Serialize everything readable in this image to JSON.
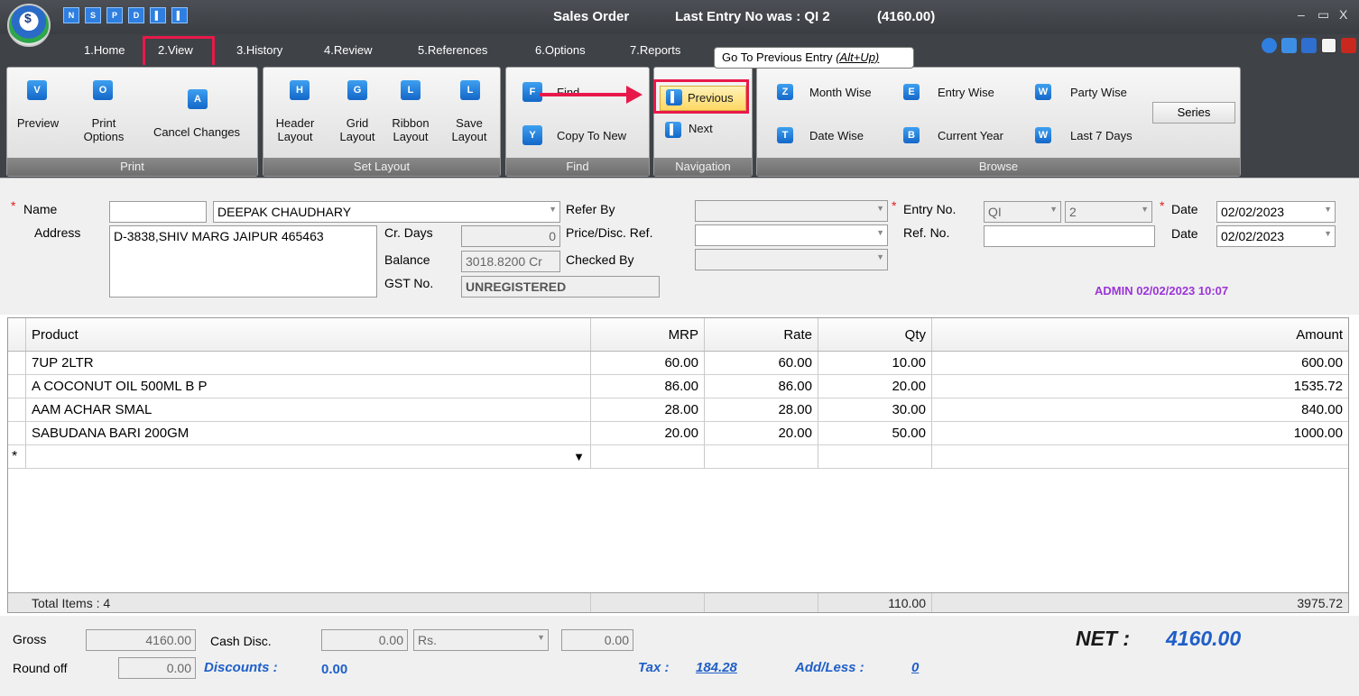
{
  "window": {
    "title": "Sales Order",
    "last_entry": "Last Entry No was : QI 2",
    "last_amount": "(4160.00)",
    "minimize": "–",
    "maximize": "▭",
    "close": "X"
  },
  "quick_access": [
    "N",
    "S",
    "P",
    "D",
    "▌",
    "▌"
  ],
  "menu": [
    "1.Home",
    "2.View",
    "3.History",
    "4.Review",
    "5.References",
    "6.Options",
    "7.Reports"
  ],
  "tooltip": {
    "text": "Go To Previous Entry ",
    "shortcut": "(Alt+Up)"
  },
  "ribbon": {
    "print": {
      "footer": "Print",
      "preview": "Preview",
      "print_options_1": "Print",
      "print_options_2": "Options",
      "cancel": "Cancel Changes",
      "icons": [
        "V",
        "O",
        "A"
      ]
    },
    "layout": {
      "footer": "Set Layout",
      "header": [
        "Header",
        "Layout"
      ],
      "grid": [
        "Grid",
        "Layout"
      ],
      "ribbon": [
        "Ribbon",
        "Layout"
      ],
      "save": [
        "Save",
        "Layout"
      ],
      "icons": [
        "H",
        "G",
        "L",
        "L"
      ]
    },
    "find": {
      "footer": "Find",
      "find": "Find",
      "copy": "Copy To New",
      "icons": [
        "F",
        "Y"
      ]
    },
    "navigation": {
      "footer": "Navigation",
      "previous": "Previous",
      "next": "Next"
    },
    "browse": {
      "footer": "Browse",
      "month": "Month Wise",
      "entry": "Entry Wise",
      "party": "Party Wise",
      "series": "Series",
      "date": "Date Wise",
      "current_year": "Current Year",
      "last7": "Last 7 Days",
      "icons": [
        "Z",
        "E",
        "W",
        "T",
        "B",
        "W"
      ]
    }
  },
  "form": {
    "name_label": "Name",
    "name_value": "DEEPAK CHAUDHARY",
    "address_label": "Address",
    "address_value": "D-3838,SHIV MARG JAIPUR 465463",
    "crdays_label": "Cr. Days",
    "crdays_value": "0",
    "balance_label": "Balance",
    "balance_value": "3018.8200 Cr",
    "gst_label": "GST No.",
    "gst_value": "UNREGISTERED",
    "refer_label": "Refer By",
    "price_label": "Price/Disc. Ref.",
    "checked_label": "Checked By",
    "entry_label": "Entry No.",
    "entry_series": "QI",
    "entry_no": "2",
    "refno_label": "Ref. No.",
    "date_label": "Date",
    "date1": "02/02/2023",
    "date2": "02/02/2023",
    "admin": "ADMIN 02/02/2023 10:07"
  },
  "grid": {
    "headers": {
      "product": "Product",
      "mrp": "MRP",
      "rate": "Rate",
      "qty": "Qty",
      "amount": "Amount"
    },
    "rows": [
      {
        "product": "7UP 2LTR",
        "mrp": "60.00",
        "rate": "60.00",
        "qty": "10.00",
        "amount": "600.00"
      },
      {
        "product": "A COCONUT OIL 500ML B P",
        "mrp": "86.00",
        "rate": "86.00",
        "qty": "20.00",
        "amount": "1535.72"
      },
      {
        "product": "AAM ACHAR SMAL",
        "mrp": "28.00",
        "rate": "28.00",
        "qty": "30.00",
        "amount": "840.00"
      },
      {
        "product": "SABUDANA BARI 200GM",
        "mrp": "20.00",
        "rate": "20.00",
        "qty": "50.00",
        "amount": "1000.00"
      }
    ],
    "new_row_marker": "*",
    "total_items": "Total Items : 4",
    "total_qty": "110.00",
    "total_amount": "3975.72"
  },
  "footer": {
    "gross_label": "Gross",
    "gross_value": "4160.00",
    "cashdisc_label": "Cash Disc.",
    "cashdisc_value": "0.00",
    "cashdisc_unit": "Rs.",
    "cashdisc_amount": "0.00",
    "roundoff_label": "Round off",
    "roundoff_value": "0.00",
    "discounts_label": "Discounts :",
    "discounts_value": "0.00",
    "tax_label": "Tax :",
    "tax_value": "184.28",
    "addless_label": "Add/Less :",
    "addless_value": "0",
    "net_label": "NET :",
    "net_value": "4160.00"
  },
  "colors": {
    "highlight": "#e8194a",
    "accent_blue": "#1f5fc8",
    "admin": "#9b35d6",
    "ribbon_dark": "#3f4247"
  }
}
